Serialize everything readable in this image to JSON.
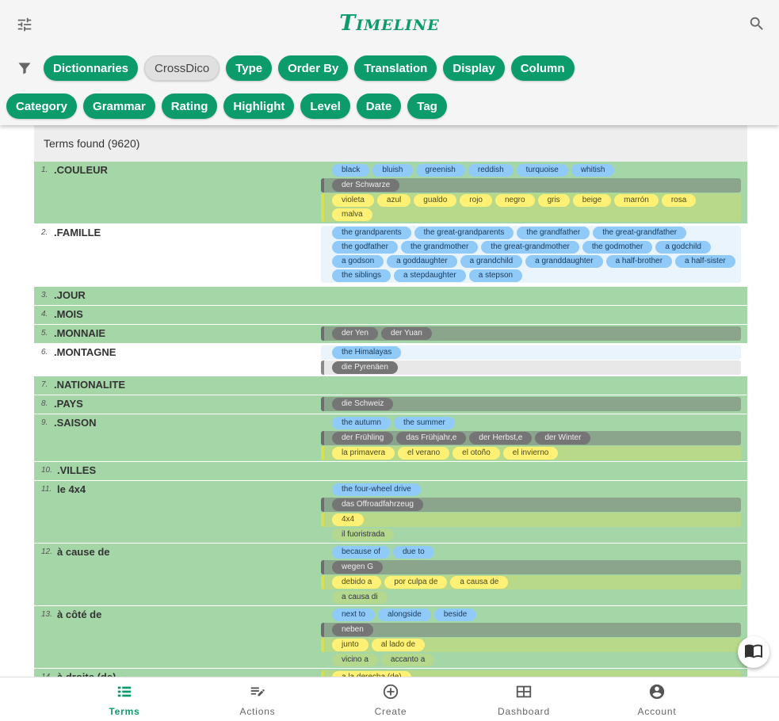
{
  "header": {
    "title": "Timeline",
    "filter_chips_row1": [
      {
        "label": "Dictionnaries",
        "style": "green"
      },
      {
        "label": "CrossDico",
        "style": "light"
      },
      {
        "label": "Type",
        "style": "green"
      },
      {
        "label": "Order By",
        "style": "green"
      },
      {
        "label": "Translation",
        "style": "green"
      },
      {
        "label": "Display",
        "style": "green"
      },
      {
        "label": "Column",
        "style": "green"
      }
    ],
    "filter_chips_row2": [
      {
        "label": "Category",
        "style": "green"
      },
      {
        "label": "Grammar",
        "style": "green"
      },
      {
        "label": "Rating",
        "style": "green"
      },
      {
        "label": "Highlight",
        "style": "green"
      },
      {
        "label": "Level",
        "style": "green"
      },
      {
        "label": "Date",
        "style": "green"
      },
      {
        "label": "Tag",
        "style": "green"
      }
    ]
  },
  "results": {
    "found_label": "Terms found (9620)"
  },
  "rows": [
    {
      "num": "1.",
      "term": ".COULEUR",
      "bg": "green",
      "height": 79,
      "groups": [
        {
          "lang": "en",
          "tags": [
            "black",
            "bluish",
            "greenish",
            "reddish",
            "turquoise",
            "whitish"
          ]
        },
        {
          "lang": "de",
          "tags": [
            "der Schwarze"
          ]
        },
        {
          "lang": "es",
          "tags": [
            "violeta",
            "azul",
            "gualdo",
            "rojo",
            "negro",
            "gris",
            "beige",
            "marrón",
            "rosa",
            "malva"
          ]
        }
      ]
    },
    {
      "num": "2.",
      "term": ".FAMILLE",
      "bg": "white",
      "height": 79,
      "groups": [
        {
          "lang": "en",
          "tags": [
            "the grandparents",
            "the great-grandparents",
            "the grandfather",
            "the great-grandfather",
            "the godfather",
            "the grandmother",
            "the great-grandmother",
            "the godmother",
            "a godchild",
            "a godson",
            "a goddaughter",
            "a grandchild",
            "a granddaughter",
            "a half-brother",
            "a half-sister",
            "the siblings",
            "a stepdaughter",
            "a stepson"
          ]
        }
      ]
    },
    {
      "num": "3.",
      "term": ".JOUR",
      "bg": "green",
      "height": 24,
      "groups": []
    },
    {
      "num": "4.",
      "term": ".MOIS",
      "bg": "green",
      "height": 24,
      "groups": []
    },
    {
      "num": "5.",
      "term": ".MONNAIE",
      "bg": "green",
      "height": 24,
      "groups": [
        {
          "lang": "de",
          "tags": [
            "der Yen",
            "der Yuan"
          ]
        }
      ]
    },
    {
      "num": "6.",
      "term": ".MONTAGNE",
      "bg": "white",
      "height": 41,
      "groups": [
        {
          "lang": "en",
          "tags": [
            "the Himalayas"
          ]
        },
        {
          "lang": "de",
          "tags": [
            "die Pyrenäen"
          ]
        }
      ]
    },
    {
      "num": "7.",
      "term": ".NATIONALITE",
      "bg": "green",
      "height": 24,
      "groups": []
    },
    {
      "num": "8.",
      "term": ".PAYS",
      "bg": "green",
      "height": 24,
      "groups": [
        {
          "lang": "de",
          "tags": [
            "die Schweiz"
          ]
        }
      ]
    },
    {
      "num": "9.",
      "term": ".SAISON",
      "bg": "green",
      "height": 60,
      "groups": [
        {
          "lang": "en",
          "tags": [
            "the autumn",
            "the summer"
          ]
        },
        {
          "lang": "de",
          "tags": [
            "der Frühling",
            "das Frühjahr,e",
            "der Herbst,e",
            "der Winter"
          ]
        },
        {
          "lang": "es",
          "tags": [
            "la primavera",
            "el verano",
            "el otoño",
            "el invierno"
          ]
        }
      ]
    },
    {
      "num": "10.",
      "term": ".VILLES",
      "bg": "green",
      "height": 24,
      "groups": []
    },
    {
      "num": "11.",
      "term": "le 4x4",
      "bg": "green",
      "height": 79,
      "groups": [
        {
          "lang": "en",
          "tags": [
            "the four-wheel drive"
          ]
        },
        {
          "lang": "de",
          "tags": [
            "das Offroadfahrzeug"
          ]
        },
        {
          "lang": "es",
          "tags": [
            "4x4"
          ]
        },
        {
          "lang": "it",
          "tags": [
            "il fuoristrada"
          ]
        }
      ]
    },
    {
      "num": "12.",
      "term": "à cause de",
      "bg": "green",
      "height": 79,
      "groups": [
        {
          "lang": "en",
          "tags": [
            "because of",
            "due to"
          ]
        },
        {
          "lang": "de",
          "tags": [
            "wegen G"
          ]
        },
        {
          "lang": "es",
          "tags": [
            "debido a",
            "por culpa de",
            "a causa de"
          ]
        },
        {
          "lang": "it",
          "tags": [
            "a causa di"
          ]
        }
      ]
    },
    {
      "num": "13.",
      "term": "à côté de",
      "bg": "green",
      "height": 79,
      "groups": [
        {
          "lang": "en",
          "tags": [
            "next to",
            "alongside",
            "beside"
          ]
        },
        {
          "lang": "de",
          "tags": [
            "neben"
          ]
        },
        {
          "lang": "es",
          "tags": [
            "junto",
            "al lado de"
          ]
        },
        {
          "lang": "it",
          "tags": [
            "vicino a",
            "accanto a"
          ]
        }
      ]
    },
    {
      "num": "14.",
      "term": "à droite (de)",
      "bg": "green",
      "height": 40,
      "groups": [
        {
          "lang": "es",
          "tags": [
            "a la derecha (de)"
          ]
        }
      ]
    }
  ],
  "bottom_nav": [
    {
      "label": "Terms",
      "icon": "list-icon",
      "active": true
    },
    {
      "label": "Actions",
      "icon": "edit-list-icon",
      "active": false
    },
    {
      "label": "Create",
      "icon": "add-circle-icon",
      "active": false
    },
    {
      "label": "Dashboard",
      "icon": "dashboard-icon",
      "active": false
    },
    {
      "label": "Account",
      "icon": "account-icon",
      "active": false
    }
  ],
  "colors": {
    "accent": "#0c9c6b",
    "row_green": "#a5d6a7",
    "tag_en": "#90caf9",
    "tag_de": "#757575",
    "tag_es": "#fff176"
  }
}
